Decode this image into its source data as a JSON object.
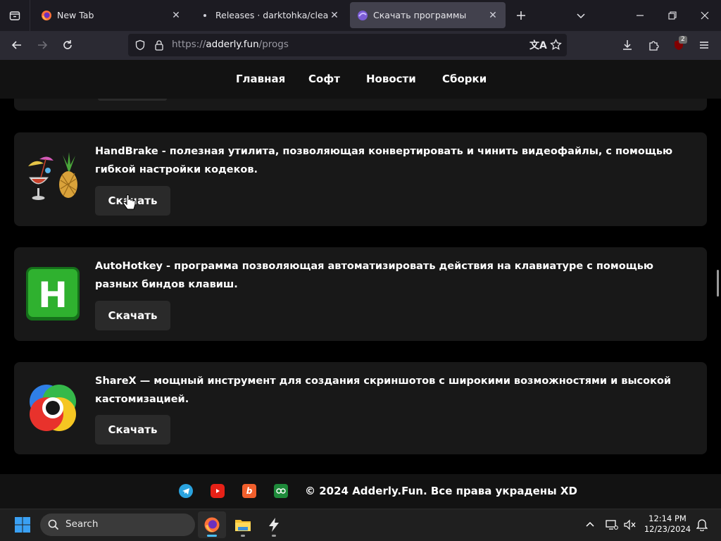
{
  "browser": {
    "tabs": [
      {
        "title": "New Tab",
        "active": false
      },
      {
        "title": "Releases · darktohka/clean-flash",
        "active": false
      },
      {
        "title": "Скачать программы",
        "active": true
      }
    ],
    "url": {
      "scheme": "https://",
      "host": "adderly.fun",
      "path": "/progs"
    },
    "extension_badge": "2"
  },
  "site": {
    "nav": [
      "Главная",
      "Софт",
      "Новости",
      "Сборки"
    ],
    "programs": [
      {
        "name": "HandBrake",
        "description": "HandBrake - полезная утилита, позволяющая конвертировать и чинить видеофайлы, с помощью гибкой настройки кодеков.",
        "download_label": "Скачать"
      },
      {
        "name": "AutoHotkey",
        "description": "AutoHotkey - программа позволяющая автоматизировать действия на клавиатуре с помощью разных биндов клавиш.",
        "download_label": "Скачать",
        "icon_letter": "H"
      },
      {
        "name": "ShareX",
        "description": "ShareX — мощный инструмент для создания скриншотов с широкими возможностями и высокой кастомизацией.",
        "download_label": "Скачать"
      }
    ],
    "footer": {
      "social": [
        "telegram-icon",
        "youtube-icon",
        "boosty-icon",
        "tracker-icon"
      ],
      "copyright": "© 2024 Adderly.Fun. Все права украдены XD"
    }
  },
  "taskbar": {
    "search_label": "Search",
    "time": "12:14 PM",
    "date": "12/23/2024"
  },
  "colors": {
    "page_bg": "#000000",
    "card_bg": "#181818",
    "button_bg": "#2a2a2a",
    "tab_active": "#42414d",
    "toolbar": "#2b2a33",
    "accent": "#4cc2ff"
  }
}
